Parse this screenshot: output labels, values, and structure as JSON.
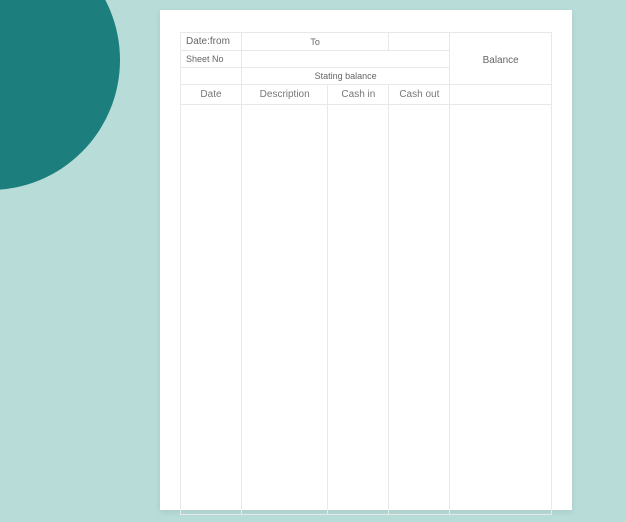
{
  "header": {
    "date_from_label": "Date:from",
    "to_label": "To",
    "balance_label": "Balance",
    "sheet_no_label": "Sheet No",
    "starting_balance_label": "Stating balance"
  },
  "columns": {
    "date": "Date",
    "description": "Description",
    "cash_in": "Cash in",
    "cash_out": "Cash out"
  }
}
